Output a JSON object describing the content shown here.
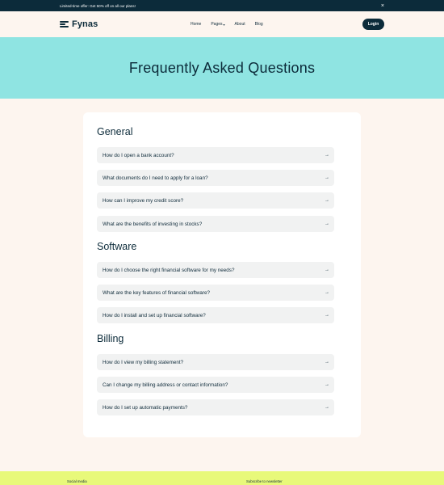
{
  "announcement": {
    "text": "Limited-time offer: Get 50% off on all our plans!",
    "close": "×"
  },
  "nav": {
    "logo": "Fynas",
    "links": [
      "Home",
      "Pages",
      "About",
      "Blog"
    ],
    "pages_caret": "▾",
    "login": "Login"
  },
  "hero": {
    "title": "Frequently Asked Questions"
  },
  "faq": {
    "arrow": "→",
    "sections": [
      {
        "title": "General",
        "questions": [
          "How do I open a bank account?",
          "What documents do I need to apply for a loan?",
          "How can I improve my credit score?",
          "What are the benefits of investing in stocks?"
        ]
      },
      {
        "title": "Software",
        "questions": [
          "How do I choose the right financial software for my needs?",
          "What are the key features of financial software?",
          "How do I install and set up financial software?"
        ]
      },
      {
        "title": "Billing",
        "questions": [
          "How do I view my billing statement?",
          "Can I change my billing address or contact information?",
          "How do I set up automatic payments?"
        ]
      }
    ]
  },
  "footer": {
    "social": "Social media",
    "newsletter": "Subscribe to newsletter"
  },
  "colors": {
    "dark": "#0c2b3a",
    "hero_bg": "#8fe4e2",
    "page_bg": "#fdf5ef",
    "footer_bg": "#e8f97a"
  }
}
